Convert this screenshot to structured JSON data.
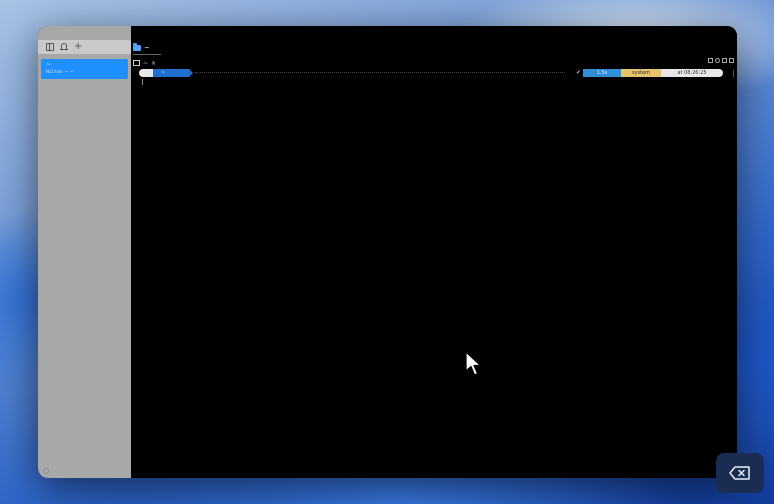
{
  "sidebar": {
    "item": {
      "title": "~",
      "subtitle": "Hilton ~ ~"
    }
  },
  "titlebar": {
    "title": "~"
  },
  "terminal_tab": {
    "label": "~",
    "close": "×"
  },
  "prompt": {
    "os_glyph": "",
    "dir": "~",
    "status_glyph": "✔",
    "duration": "1.5s",
    "context": "system",
    "clock": "at 08:26:25"
  },
  "colors": {
    "sidebar_bg": "#a8a8a8",
    "selection": "#1e90ff",
    "terminal_bg": "#000000",
    "dir_segment": "#1f6fd1",
    "time_segment": "#2f8fd9",
    "context_segment": "#e6c46b"
  },
  "icons": [
    "sidebar-toggle-icon",
    "bell-icon",
    "plus-icon",
    "folder-icon",
    "terminal-icon",
    "check-icon",
    "mouse-pointer-icon",
    "backspace-icon"
  ]
}
